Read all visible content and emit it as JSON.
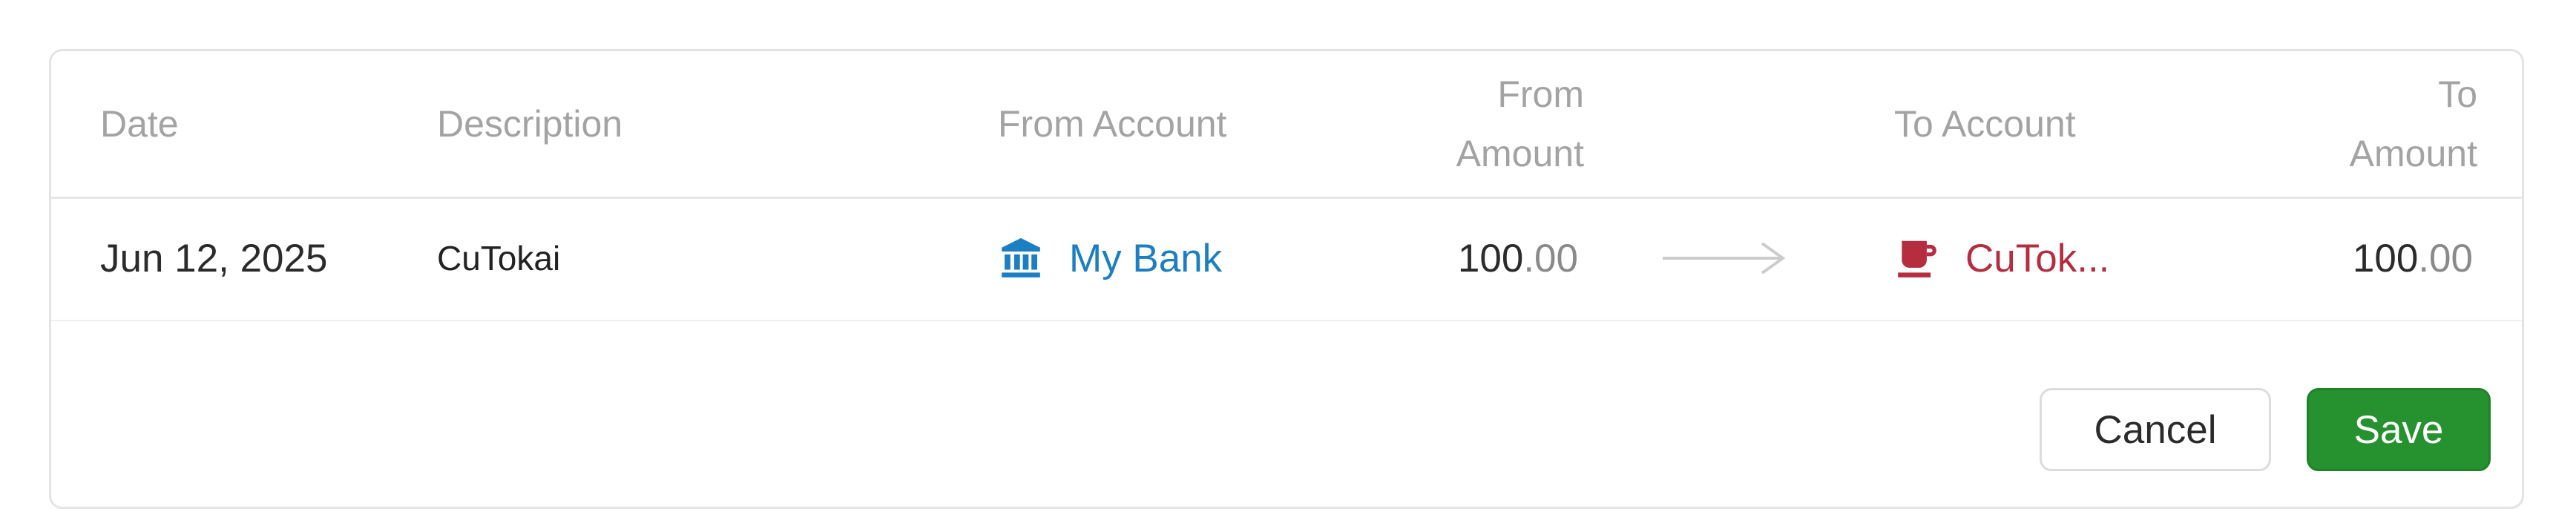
{
  "table": {
    "headers": {
      "date": "Date",
      "description": "Description",
      "from_account": "From Account",
      "from_amount_line1": "From",
      "from_amount_line2": "Amount",
      "to_account": "To Account",
      "to_amount_line1": "To",
      "to_amount_line2": "Amount"
    },
    "row": {
      "date": "Jun 12, 2025",
      "description": "CuTokai",
      "from_account": "My Bank",
      "from_account_icon": "bank-icon",
      "from_amount_int": "100",
      "from_amount_dec": ".00",
      "to_account": "CuTok...",
      "to_account_icon": "coffee-cup-icon",
      "to_amount_int": "100",
      "to_amount_dec": ".00"
    }
  },
  "actions": {
    "cancel_label": "Cancel",
    "save_label": "Save"
  },
  "colors": {
    "from_account": "#1b7fc1",
    "to_account": "#b52d3e",
    "save_button": "#26912f",
    "header_text": "#a3a3a3"
  }
}
